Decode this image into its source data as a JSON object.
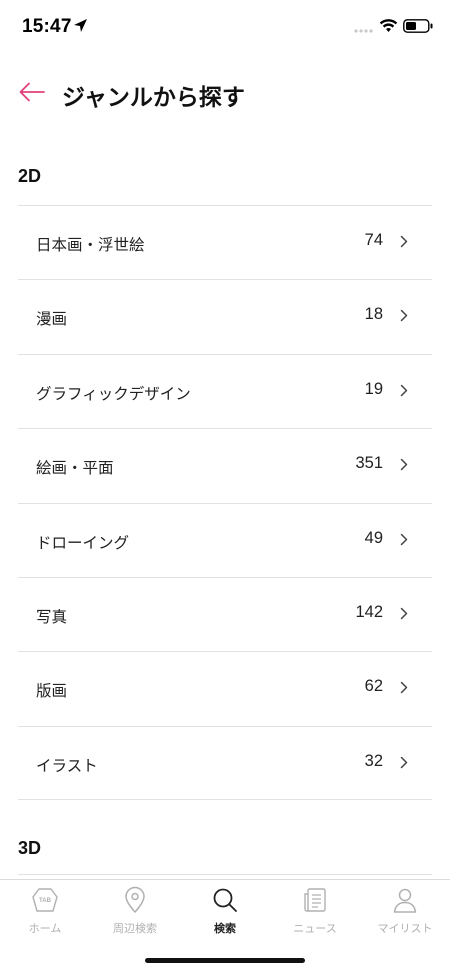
{
  "status_bar": {
    "time": "15:47"
  },
  "header": {
    "title": "ジャンルから探す"
  },
  "sections": [
    {
      "title": "2D"
    },
    {
      "title": "3D"
    }
  ],
  "genres": [
    {
      "label": "日本画・浮世絵",
      "count": "74"
    },
    {
      "label": "漫画",
      "count": "18"
    },
    {
      "label": "グラフィックデザイン",
      "count": "19"
    },
    {
      "label": "絵画・平面",
      "count": "351"
    },
    {
      "label": "ドローイング",
      "count": "49"
    },
    {
      "label": "写真",
      "count": "142"
    },
    {
      "label": "版画",
      "count": "62"
    },
    {
      "label": "イラスト",
      "count": "32"
    }
  ],
  "tab_bar": {
    "tabs": [
      {
        "label": "ホーム",
        "icon": "tab-logo-icon",
        "badge_text": "TAB"
      },
      {
        "label": "周辺検索",
        "icon": "location-pin-icon"
      },
      {
        "label": "検索",
        "icon": "search-icon",
        "active": true
      },
      {
        "label": "ニュース",
        "icon": "news-icon"
      },
      {
        "label": "マイリスト",
        "icon": "person-icon"
      }
    ]
  },
  "colors": {
    "accent": "#e0407a",
    "text": "#111111",
    "divider": "#e2e2e2",
    "inactive": "#b0b0b0"
  }
}
